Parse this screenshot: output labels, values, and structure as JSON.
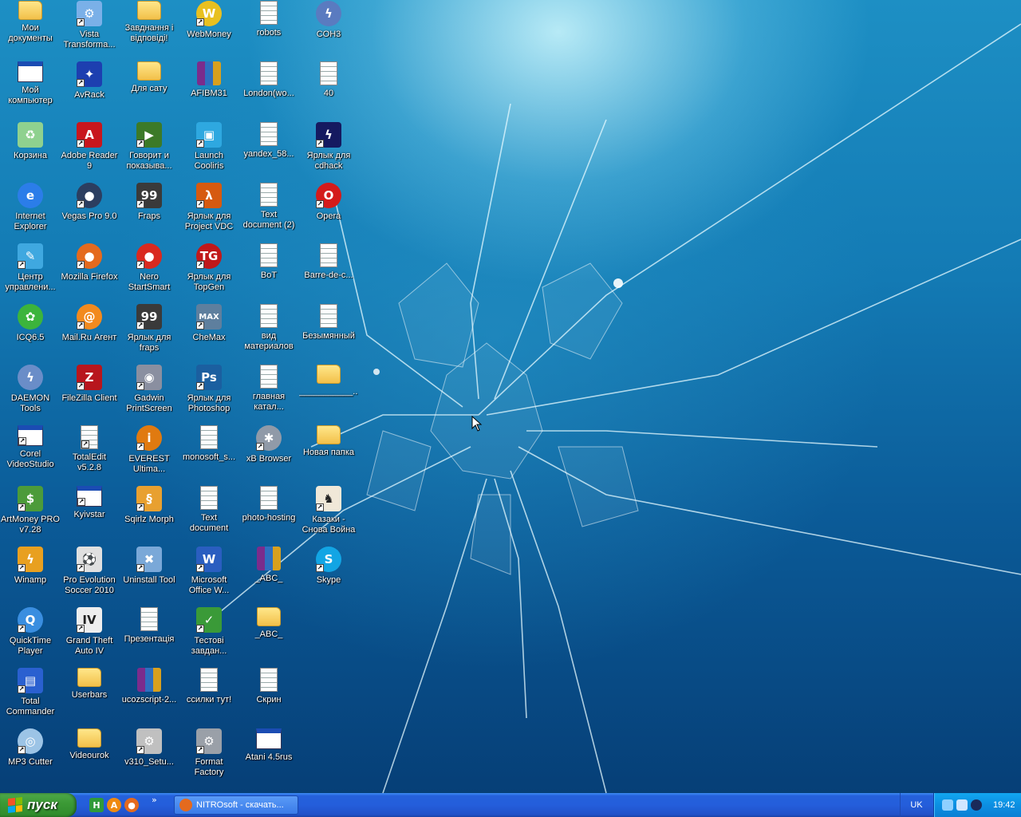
{
  "desktop": {
    "icons": [
      {
        "label": "Мои\nдокументы",
        "icon": "my-documents-icon",
        "shape": "folder",
        "color": "#ffd65a",
        "glyph": ""
      },
      {
        "label": "Мой\nкомпьютер",
        "icon": "my-computer-icon",
        "shape": "win",
        "color": "#cfe6ff",
        "glyph": ""
      },
      {
        "label": "Корзина",
        "icon": "recycle-bin-icon",
        "shape": "box",
        "color": "#8fd18f",
        "glyph": "♻"
      },
      {
        "label": "Internet\nExplorer",
        "icon": "internet-explorer-icon",
        "shape": "round",
        "color": "#2b7de9",
        "glyph": "e"
      },
      {
        "label": "Центр\nуправлени...",
        "icon": "control-center-icon",
        "shape": "box",
        "color": "#3fa8e0",
        "glyph": "✎",
        "shortcut": true
      },
      {
        "label": "ICQ6.5",
        "icon": "icq-icon",
        "shape": "round",
        "color": "#3cb43c",
        "glyph": "✿"
      },
      {
        "label": "DAEMON Tools\nLite",
        "icon": "daemon-tools-icon",
        "shape": "round",
        "color": "#6a8dc8",
        "glyph": "ϟ"
      },
      {
        "label": "Corel\nVideoStudio 12",
        "icon": "corel-videostudio-icon",
        "shape": "win",
        "color": "#ffffff",
        "glyph": "",
        "shortcut": true
      },
      {
        "label": "ArtMoney PRO\nv7.28",
        "icon": "artmoney-icon",
        "shape": "box",
        "color": "#4c9b3a",
        "glyph": "$",
        "shortcut": true
      },
      {
        "label": "Winamp",
        "icon": "winamp-icon",
        "shape": "box",
        "color": "#e8a020",
        "glyph": "ϟ",
        "shortcut": true
      },
      {
        "label": "QuickTime\nPlayer",
        "icon": "quicktime-icon",
        "shape": "round",
        "color": "#3a8ee0",
        "glyph": "Q",
        "shortcut": true
      },
      {
        "label": "Total\nCommander",
        "icon": "total-commander-icon",
        "shape": "box",
        "color": "#2a60d0",
        "glyph": "▤",
        "shortcut": true
      },
      {
        "label": "MP3 Cutter",
        "icon": "mp3-cutter-icon",
        "shape": "round",
        "color": "#9cc4e6",
        "glyph": "◎",
        "shortcut": true
      },
      {
        "label": "Vista\nTransforma...",
        "icon": "vista-transformation-icon",
        "shape": "box",
        "color": "#7ab0e8",
        "glyph": "⚙",
        "shortcut": true
      },
      {
        "label": "AvRack",
        "icon": "avrack-icon",
        "shape": "box",
        "color": "#1d3fb0",
        "glyph": "✦",
        "shortcut": true
      },
      {
        "label": "Adobe Reader\n9",
        "icon": "adobe-reader-icon",
        "shape": "box",
        "color": "#c8161d",
        "glyph": "A",
        "shortcut": true
      },
      {
        "label": "Vegas Pro 9.0",
        "icon": "vegas-pro-icon",
        "shape": "round",
        "color": "#2c3e60",
        "glyph": "●",
        "shortcut": true
      },
      {
        "label": "Mozilla Firefox",
        "icon": "firefox-icon",
        "shape": "round",
        "color": "#e46a1e",
        "glyph": "●",
        "shortcut": true
      },
      {
        "label": "Mail.Ru Агент",
        "icon": "mailru-agent-icon",
        "shape": "round",
        "color": "#f28a1e",
        "glyph": "@",
        "shortcut": true
      },
      {
        "label": "FileZilla Client",
        "icon": "filezilla-icon",
        "shape": "box",
        "color": "#b8161d",
        "glyph": "Z",
        "shortcut": true
      },
      {
        "label": "TotalEdit\nv5.2.8",
        "icon": "totaledit-icon",
        "shape": "doc",
        "color": "#ffffff",
        "glyph": "",
        "shortcut": true
      },
      {
        "label": "Kyivstar",
        "icon": "kyivstar-icon",
        "shape": "win",
        "color": "#dde",
        "glyph": "",
        "shortcut": true
      },
      {
        "label": "Pro Evolution\nSoccer 2010",
        "icon": "pes-2010-icon",
        "shape": "box",
        "color": "#e0e0e0",
        "glyph": "⚽",
        "shortcut": true
      },
      {
        "label": "Grand Theft\nAuto IV",
        "icon": "gta4-icon",
        "shape": "box",
        "color": "#eeeeee",
        "glyph": "IV",
        "shortcut": true,
        "dark": true
      },
      {
        "label": "Userbars",
        "icon": "folder-icon",
        "shape": "folder",
        "color": "#ffd65a",
        "glyph": ""
      },
      {
        "label": "Videourok",
        "icon": "folder-icon",
        "shape": "folder",
        "color": "#ffd65a",
        "glyph": ""
      },
      {
        "label": "Завднання і\nвідповіді!",
        "icon": "folder-icon",
        "shape": "folder",
        "color": "#ffd65a",
        "glyph": ""
      },
      {
        "label": "Для сату",
        "icon": "folder-icon",
        "shape": "folder",
        "color": "#ffd65a",
        "glyph": ""
      },
      {
        "label": "Говорит и\nпоказыва...",
        "icon": "video-shortcut-icon",
        "shape": "box",
        "color": "#3c7a28",
        "glyph": "▶",
        "shortcut": true
      },
      {
        "label": "Fraps",
        "icon": "fraps-icon",
        "shape": "box",
        "color": "#3a3a3a",
        "glyph": "99",
        "shortcut": true
      },
      {
        "label": "Nero\nStartSmart",
        "icon": "nero-icon",
        "shape": "round",
        "color": "#d9291f",
        "glyph": "●",
        "shortcut": true
      },
      {
        "label": "Ярлык для\nfraps",
        "icon": "fraps-icon",
        "shape": "box",
        "color": "#3a3a3a",
        "glyph": "99",
        "shortcut": true
      },
      {
        "label": "Gadwin\nPrintScreen",
        "icon": "gadwin-printscreen-icon",
        "shape": "box",
        "color": "#8a8fa0",
        "glyph": "◉",
        "shortcut": true
      },
      {
        "label": "EVEREST\nUltima...",
        "icon": "everest-icon",
        "shape": "round",
        "color": "#e07a10",
        "glyph": "i",
        "shortcut": true
      },
      {
        "label": "Sqirlz Morph",
        "icon": "sqirlz-morph-icon",
        "shape": "box",
        "color": "#e8a030",
        "glyph": "§",
        "shortcut": true
      },
      {
        "label": "Uninstall Tool",
        "icon": "uninstall-tool-icon",
        "shape": "box",
        "color": "#7aa8d8",
        "glyph": "✖",
        "shortcut": true
      },
      {
        "label": "Презентація",
        "icon": "presentation-doc-icon",
        "shape": "doc",
        "color": "#ffffff",
        "glyph": ""
      },
      {
        "label": "ucozscript-2...",
        "icon": "winrar-archive-icon",
        "shape": "rar",
        "color": "#7b2c8c",
        "glyph": ""
      },
      {
        "label": "v310_Setu...",
        "icon": "setup-icon",
        "shape": "box",
        "color": "#c0c0c0",
        "glyph": "⚙",
        "shortcut": true
      },
      {
        "label": "WebMoney",
        "icon": "webmoney-icon",
        "shape": "round",
        "color": "#e8c020",
        "glyph": "W",
        "shortcut": true
      },
      {
        "label": "AFIBM31",
        "icon": "winrar-archive-icon",
        "shape": "rar",
        "color": "#7b2c8c",
        "glyph": ""
      },
      {
        "label": "Launch Cooliris",
        "icon": "cooliris-icon",
        "shape": "box",
        "color": "#2ea8e0",
        "glyph": "▣",
        "shortcut": true
      },
      {
        "label": "Ярлык для\nProject VDC",
        "icon": "half-life-icon",
        "shape": "box",
        "color": "#d65a10",
        "glyph": "λ",
        "shortcut": true
      },
      {
        "label": "Ярлык для\nTopGen",
        "icon": "topgen-icon",
        "shape": "round",
        "color": "#c0181a",
        "glyph": "TG",
        "shortcut": true
      },
      {
        "label": "CheMax",
        "icon": "chemax-icon",
        "shape": "box",
        "color": "#5e7f9e",
        "glyph": "MAX",
        "shortcut": true
      },
      {
        "label": "Ярлык для\nPhotoshop",
        "icon": "photoshop-icon",
        "shape": "box",
        "color": "#1b5fa0",
        "glyph": "Ps",
        "shortcut": true
      },
      {
        "label": "monosoft_s...",
        "icon": "image-file-icon",
        "shape": "doc",
        "color": "#ffffff",
        "glyph": ""
      },
      {
        "label": "Text\ndocument",
        "icon": "text-document-icon",
        "shape": "doc",
        "color": "#ffffff",
        "glyph": ""
      },
      {
        "label": "Microsoft\nOffice W...",
        "icon": "ms-word-icon",
        "shape": "box",
        "color": "#2a5ec0",
        "glyph": "W",
        "shortcut": true
      },
      {
        "label": "Тестові\nзавдан...",
        "icon": "test-tasks-icon",
        "shape": "box",
        "color": "#3a9a38",
        "glyph": "✓",
        "shortcut": true
      },
      {
        "label": "ссилки тут!",
        "icon": "text-document-icon",
        "shape": "doc",
        "color": "#ffffff",
        "glyph": ""
      },
      {
        "label": "Format\nFactory",
        "icon": "format-factory-icon",
        "shape": "box",
        "color": "#9aa0a8",
        "glyph": "⚙",
        "shortcut": true
      },
      {
        "label": "robots",
        "icon": "text-document-icon",
        "shape": "doc",
        "color": "#ffffff",
        "glyph": ""
      },
      {
        "label": "London(wo...",
        "icon": "text-document-icon",
        "shape": "doc",
        "color": "#ffffff",
        "glyph": ""
      },
      {
        "label": "yandex_58...",
        "icon": "text-document-icon",
        "shape": "doc",
        "color": "#ffffff",
        "glyph": ""
      },
      {
        "label": "Text\ndocument (2)",
        "icon": "text-document-icon",
        "shape": "doc",
        "color": "#ffffff",
        "glyph": ""
      },
      {
        "label": "BoT",
        "icon": "text-document-icon",
        "shape": "doc",
        "color": "#ffffff",
        "glyph": ""
      },
      {
        "label": "вид\nматериалов",
        "icon": "text-document-icon",
        "shape": "doc",
        "color": "#ffffff",
        "glyph": ""
      },
      {
        "label": "главная\nкатал...",
        "icon": "text-document-icon",
        "shape": "doc",
        "color": "#ffffff",
        "glyph": ""
      },
      {
        "label": "xB Browser",
        "icon": "xb-browser-icon",
        "shape": "round",
        "color": "#909aa8",
        "glyph": "✱",
        "shortcut": true
      },
      {
        "label": "photo-hosting",
        "icon": "image-file-icon",
        "shape": "doc",
        "color": "#ffffff",
        "glyph": ""
      },
      {
        "label": "_ABC_",
        "icon": "winrar-archive-icon",
        "shape": "rar",
        "color": "#7b2c8c",
        "glyph": ""
      },
      {
        "label": "_ABC_",
        "icon": "folder-icon",
        "shape": "folder",
        "color": "#ffd65a",
        "glyph": ""
      },
      {
        "label": "Скрин",
        "icon": "screenshot-image-icon",
        "shape": "doc",
        "color": "#ffffff",
        "glyph": ""
      },
      {
        "label": "Atani 4.5rus",
        "icon": "atani-icon",
        "shape": "win",
        "color": "#ffffff",
        "glyph": ""
      },
      {
        "label": "COH3",
        "icon": "coh3-icon",
        "shape": "round",
        "color": "#5a7bc0",
        "glyph": "ϟ"
      },
      {
        "label": "40",
        "icon": "web-file-icon",
        "shape": "doc",
        "color": "#ffffff",
        "glyph": ""
      },
      {
        "label": "Ярлык для\ncdhack",
        "icon": "cdhack-icon",
        "shape": "box",
        "color": "#151a60",
        "glyph": "ϟ",
        "shortcut": true
      },
      {
        "label": "Opera",
        "icon": "opera-icon",
        "shape": "round",
        "color": "#d41b1b",
        "glyph": "O",
        "shortcut": true
      },
      {
        "label": "Barre-de-c...",
        "icon": "image-file-icon",
        "shape": "doc",
        "color": "#ffffff",
        "glyph": ""
      },
      {
        "label": "Безымянный",
        "icon": "image-file-icon",
        "shape": "doc",
        "color": "#ffffff",
        "glyph": ""
      },
      {
        "label": "___________...",
        "icon": "folder-icon",
        "shape": "folder",
        "color": "#ffd65a",
        "glyph": ""
      },
      {
        "label": "Новая папка",
        "icon": "folder-icon",
        "shape": "folder",
        "color": "#ffd65a",
        "glyph": ""
      },
      {
        "label": "Казаки -\nСнова Война",
        "icon": "cossacks-icon",
        "shape": "box",
        "color": "#f0e8d8",
        "glyph": "♞",
        "shortcut": true,
        "dark": true
      },
      {
        "label": "Skype",
        "icon": "skype-icon",
        "shape": "round",
        "color": "#12a5e4",
        "glyph": "S",
        "shortcut": true
      }
    ]
  },
  "taskbar": {
    "start_label": "пуск",
    "quick_launch": [
      {
        "icon": "show-desktop-icon",
        "color": "#2f9a3a",
        "glyph": "H"
      },
      {
        "icon": "avast-icon",
        "color": "#f08a10",
        "glyph": "A"
      },
      {
        "icon": "firefox-icon",
        "color": "#e46a1e",
        "glyph": "●"
      }
    ],
    "quick_launch_chevron": "»",
    "active_task": {
      "icon": "firefox-icon",
      "label": "NITROsoft - скачать..."
    },
    "language": "UK",
    "tray": [
      {
        "icon": "network-icon",
        "color": "#8fd0ff"
      },
      {
        "icon": "display-icon",
        "color": "#d0e6ff"
      },
      {
        "icon": "volume-icon",
        "color": "#1a2a5a"
      }
    ],
    "clock": "19:42"
  }
}
